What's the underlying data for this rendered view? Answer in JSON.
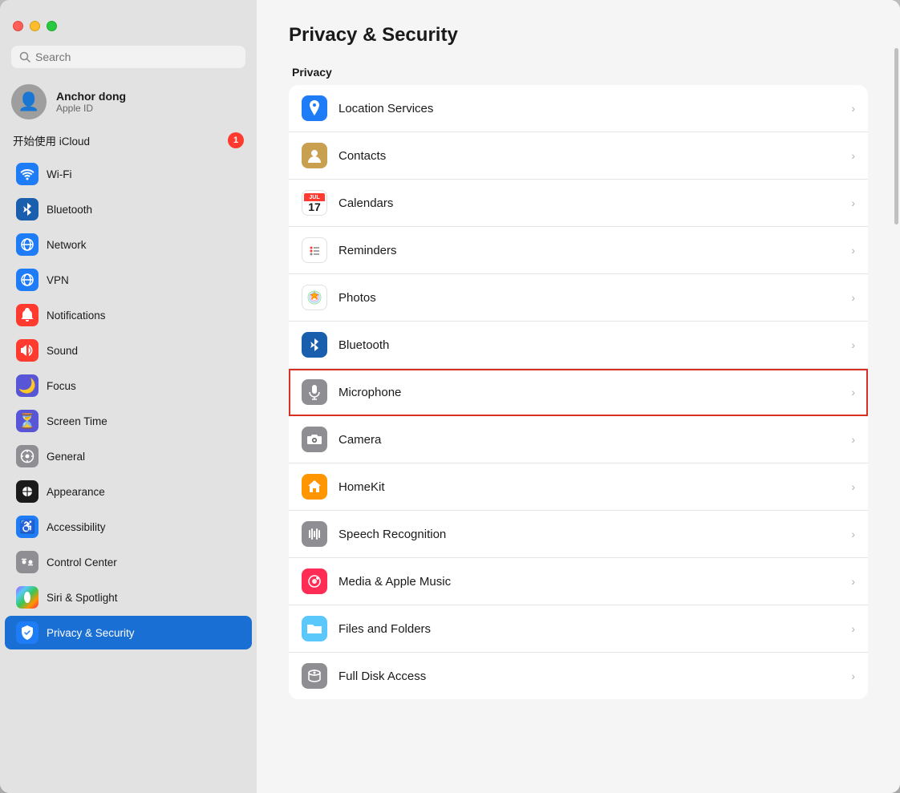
{
  "window": {
    "title": "Privacy & Security"
  },
  "trafficLights": {
    "red": "close",
    "yellow": "minimize",
    "green": "maximize"
  },
  "search": {
    "placeholder": "Search"
  },
  "user": {
    "name": "Anchor dong",
    "subtitle": "Apple ID"
  },
  "icloud": {
    "label": "开始使用 iCloud",
    "badge": "1"
  },
  "sidebar": {
    "items": [
      {
        "id": "wifi",
        "label": "Wi-Fi",
        "iconColor": "#1e7cf7",
        "iconType": "wifi"
      },
      {
        "id": "bluetooth",
        "label": "Bluetooth",
        "iconColor": "#1a5fad",
        "iconType": "bluetooth"
      },
      {
        "id": "network",
        "label": "Network",
        "iconColor": "#1e7cf7",
        "iconType": "network"
      },
      {
        "id": "vpn",
        "label": "VPN",
        "iconColor": "#1e7cf7",
        "iconType": "vpn"
      },
      {
        "id": "notifications",
        "label": "Notifications",
        "iconColor": "#ff3b30",
        "iconType": "notifications"
      },
      {
        "id": "sound",
        "label": "Sound",
        "iconColor": "#ff3b30",
        "iconType": "sound"
      },
      {
        "id": "focus",
        "label": "Focus",
        "iconColor": "#5856d6",
        "iconType": "focus"
      },
      {
        "id": "screentime",
        "label": "Screen Time",
        "iconColor": "#5856d6",
        "iconType": "screentime"
      },
      {
        "id": "general",
        "label": "General",
        "iconColor": "#8e8e93",
        "iconType": "general"
      },
      {
        "id": "appearance",
        "label": "Appearance",
        "iconColor": "#1a1a1a",
        "iconType": "appearance"
      },
      {
        "id": "accessibility",
        "label": "Accessibility",
        "iconColor": "#1e7cf7",
        "iconType": "accessibility"
      },
      {
        "id": "controlcenter",
        "label": "Control Center",
        "iconColor": "#8e8e93",
        "iconType": "controlcenter"
      },
      {
        "id": "siri",
        "label": "Siri & Spotlight",
        "iconColor": "#a855f7",
        "iconType": "siri"
      },
      {
        "id": "privacy",
        "label": "Privacy & Security",
        "iconColor": "#1e7cf7",
        "iconType": "privacy",
        "active": true
      }
    ]
  },
  "main": {
    "title": "Privacy & Security",
    "sectionHeader": "Privacy",
    "listItems": [
      {
        "id": "location",
        "label": "Location Services",
        "iconColor": "#1e7cf7",
        "iconType": "location",
        "highlighted": false
      },
      {
        "id": "contacts",
        "label": "Contacts",
        "iconColor": "#c8a050",
        "iconType": "contacts",
        "highlighted": false
      },
      {
        "id": "calendars",
        "label": "Calendars",
        "iconColor": "#ff3b30",
        "iconType": "calendars",
        "highlighted": false
      },
      {
        "id": "reminders",
        "label": "Reminders",
        "iconColor": "#ff3b30",
        "iconType": "reminders",
        "highlighted": false
      },
      {
        "id": "photos",
        "label": "Photos",
        "iconColor": "#ff9500",
        "iconType": "photos",
        "highlighted": false
      },
      {
        "id": "bluetooth",
        "label": "Bluetooth",
        "iconColor": "#1a5fad",
        "iconType": "bluetooth",
        "highlighted": false
      },
      {
        "id": "microphone",
        "label": "Microphone",
        "iconColor": "#8e8e93",
        "iconType": "microphone",
        "highlighted": true
      },
      {
        "id": "camera",
        "label": "Camera",
        "iconColor": "#8e8e93",
        "iconType": "camera",
        "highlighted": false
      },
      {
        "id": "homekit",
        "label": "HomeKit",
        "iconColor": "#ff9500",
        "iconType": "homekit",
        "highlighted": false
      },
      {
        "id": "speech",
        "label": "Speech Recognition",
        "iconColor": "#8e8e93",
        "iconType": "speech",
        "highlighted": false
      },
      {
        "id": "media",
        "label": "Media & Apple Music",
        "iconColor": "#ff2d55",
        "iconType": "media",
        "highlighted": false
      },
      {
        "id": "files",
        "label": "Files and Folders",
        "iconColor": "#5ac8fa",
        "iconType": "files",
        "highlighted": false
      },
      {
        "id": "fulldisk",
        "label": "Full Disk Access",
        "iconColor": "#8e8e93",
        "iconType": "fulldisk",
        "highlighted": false
      }
    ]
  }
}
